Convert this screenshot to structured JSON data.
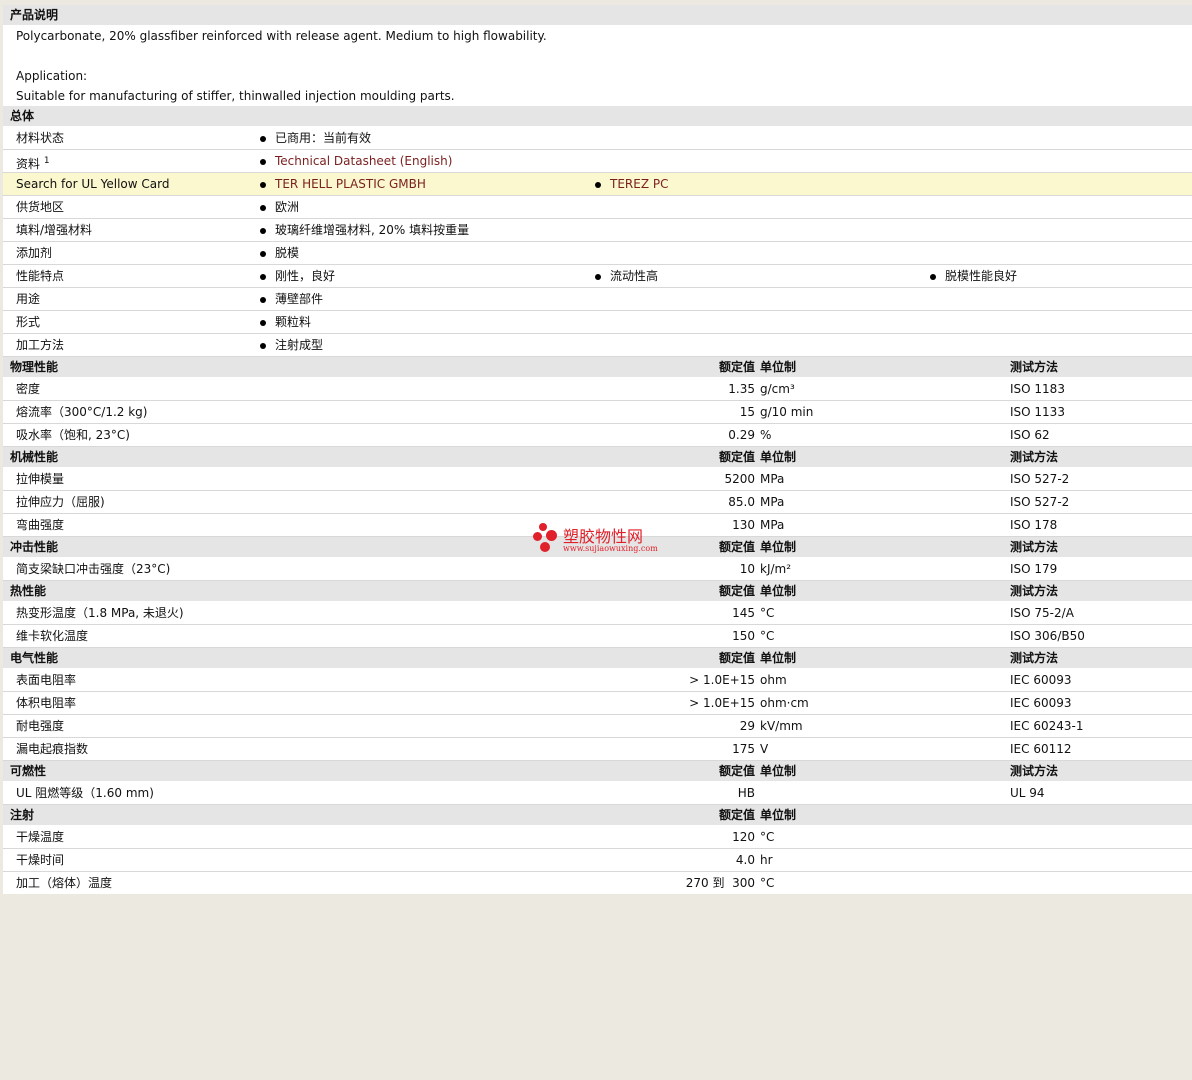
{
  "product": {
    "title": "产品说明",
    "desc": "Polycarbonate, 20% glassfiber reinforced with release agent. Medium to high flowability.",
    "app_label": "Application:",
    "app_text": "Suitable for manufacturing of stiffer, thinwalled injection moulding parts."
  },
  "general": {
    "title": "总体",
    "material_status": {
      "label": "材料状态",
      "value": "已商用：当前有效"
    },
    "source": {
      "label": "资料",
      "sup": "1",
      "value": "Technical Datasheet (English)"
    },
    "ul_search": {
      "label": "Search for UL Yellow Card",
      "v1": "TER HELL PLASTIC GMBH",
      "v2": "TEREZ PC"
    },
    "supply_region": {
      "label": "供货地区",
      "value": "欧洲"
    },
    "filler": {
      "label": "填料/增强材料",
      "value": "玻璃纤维增强材料, 20% 填料按重量"
    },
    "additive": {
      "label": "添加剂",
      "value": "脱模"
    },
    "features": {
      "label": "性能特点",
      "v1": "刚性，良好",
      "v2": "流动性高",
      "v3": "脱模性能良好"
    },
    "uses": {
      "label": "用途",
      "value": "薄壁部件"
    },
    "form": {
      "label": "形式",
      "value": "颗粒料"
    },
    "processing": {
      "label": "加工方法",
      "value": "注射成型"
    }
  },
  "col_headers": {
    "value": "额定值",
    "unit": "单位制",
    "method": "测试方法"
  },
  "physical": {
    "title": "物理性能",
    "rows": [
      {
        "label": "密度",
        "value": "1.35",
        "unit": "g/cm³",
        "method": "ISO 1183"
      },
      {
        "label": "熔流率（300°C/1.2 kg)",
        "value": "15",
        "unit": "g/10 min",
        "method": "ISO 1133"
      },
      {
        "label": "吸水率（饱和, 23°C)",
        "value": "0.29",
        "unit": "%",
        "method": "ISO 62"
      }
    ]
  },
  "mechanical": {
    "title": "机械性能",
    "rows": [
      {
        "label": "拉伸模量",
        "value": "5200",
        "unit": "MPa",
        "method": "ISO 527-2"
      },
      {
        "label": "拉伸应力（屈服)",
        "value": "85.0",
        "unit": "MPa",
        "method": "ISO 527-2"
      },
      {
        "label": "弯曲强度",
        "value": "130",
        "unit": "MPa",
        "method": "ISO 178"
      }
    ]
  },
  "impact": {
    "title": "冲击性能",
    "rows": [
      {
        "label": "简支梁缺口冲击强度（23°C)",
        "value": "10",
        "unit": "kJ/m²",
        "method": "ISO 179"
      }
    ]
  },
  "thermal": {
    "title": "热性能",
    "rows": [
      {
        "label": "热变形温度（1.8 MPa, 未退火)",
        "value": "145",
        "unit": "°C",
        "method": "ISO 75-2/A"
      },
      {
        "label": "维卡软化温度",
        "value": "150",
        "unit": "°C",
        "method": "ISO 306/B50"
      }
    ]
  },
  "electrical": {
    "title": "电气性能",
    "rows": [
      {
        "label": "表面电阻率",
        "value": "> 1.0E+15",
        "unit": "ohm",
        "method": "IEC 60093"
      },
      {
        "label": "体积电阻率",
        "value": "> 1.0E+15",
        "unit": "ohm·cm",
        "method": "IEC 60093"
      },
      {
        "label": "耐电强度",
        "value": "29",
        "unit": "kV/mm",
        "method": "IEC 60243-1"
      },
      {
        "label": "漏电起痕指数",
        "value": "175",
        "unit": "V",
        "method": "IEC 60112"
      }
    ]
  },
  "flammability": {
    "title": "可燃性",
    "rows": [
      {
        "label": "UL 阻燃等级（1.60 mm)",
        "value": "HB",
        "unit": "",
        "method": "UL 94"
      }
    ]
  },
  "injection": {
    "title": "注射",
    "rows": [
      {
        "label": "干燥温度",
        "value": "120",
        "unit": "°C",
        "method": ""
      },
      {
        "label": "干燥时间",
        "value": "4.0",
        "unit": "hr",
        "method": ""
      },
      {
        "label": "加工（熔体）温度",
        "value": "270 到  300",
        "unit": "°C",
        "method": ""
      }
    ]
  },
  "watermark": {
    "name": "塑胶物性网",
    "url": "www.sujiaowuxing.com"
  },
  "colors": {
    "header_bg": "#E5E5E5",
    "highlight_bg": "#FBF7CF",
    "link": "#7A1F1F",
    "page_bg": "#ECE9E1"
  }
}
